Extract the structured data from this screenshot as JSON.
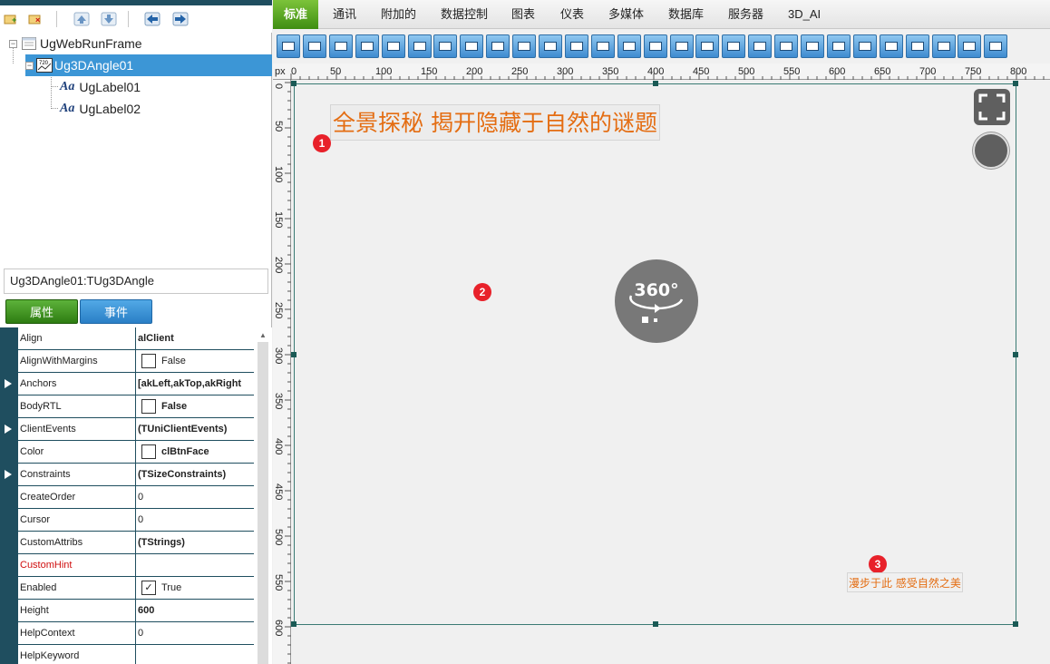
{
  "tree": {
    "root": "UgWebRunFrame",
    "selected": "Ug3DAngle01",
    "children": [
      "UgLabel01",
      "UgLabel02"
    ]
  },
  "component_name": "Ug3DAngle01:TUg3DAngle",
  "prop_tabs": {
    "properties": "属性",
    "events": "事件"
  },
  "properties": [
    {
      "name": "Align",
      "value": "alClient",
      "bold": true
    },
    {
      "name": "AlignWithMargins",
      "value": "False",
      "checkbox": "",
      "bold": false
    },
    {
      "name": "Anchors",
      "value": "[akLeft,akTop,akRight",
      "bold": true,
      "expandable": true
    },
    {
      "name": "BodyRTL",
      "value": "False",
      "checkbox": "",
      "bold": true
    },
    {
      "name": "ClientEvents",
      "value": "(TUniClientEvents)",
      "bold": true,
      "expandable": true
    },
    {
      "name": "Color",
      "value": "clBtnFace",
      "checkbox": "",
      "bold": true
    },
    {
      "name": "Constraints",
      "value": "(TSizeConstraints)",
      "bold": true,
      "expandable": true
    },
    {
      "name": "CreateOrder",
      "value": "0",
      "bold": false
    },
    {
      "name": "Cursor",
      "value": "0",
      "bold": false
    },
    {
      "name": "CustomAttribs",
      "value": "(TStrings)",
      "bold": true
    },
    {
      "name": "CustomHint",
      "value": "",
      "bold": false,
      "red": true
    },
    {
      "name": "Enabled",
      "value": "True",
      "checkbox": "✓",
      "bold": false
    },
    {
      "name": "Height",
      "value": "600",
      "bold": true
    },
    {
      "name": "HelpContext",
      "value": "0",
      "bold": false
    },
    {
      "name": "HelpKeyword",
      "value": "",
      "bold": false
    }
  ],
  "menu_tabs": [
    "标准",
    "通讯",
    "附加的",
    "数据控制",
    "图表",
    "仪表",
    "多媒体",
    "数据库",
    "服务器",
    "3D_AI"
  ],
  "active_tab": "标准",
  "ruler": {
    "unit": "px",
    "top_labels": [
      "0",
      "50",
      "100",
      "150",
      "200",
      "250",
      "300",
      "350",
      "400",
      "450",
      "500",
      "550",
      "600",
      "650",
      "700",
      "750",
      "800"
    ],
    "left_labels": [
      "0",
      "50",
      "100",
      "150",
      "200",
      "250",
      "300",
      "350",
      "400",
      "450",
      "500",
      "550",
      "600"
    ]
  },
  "canvas": {
    "title_text": "全景探秘 揭开隐藏于自然的谜题",
    "sub_text": "漫步于此 感受自然之美",
    "pano_text": "360°",
    "badges": [
      "1",
      "2",
      "3"
    ]
  },
  "colors": {
    "accent_green": "#3f8e12",
    "accent_blue": "#3c96d6",
    "label_orange": "#e46d12",
    "badge_red": "#e8212a",
    "frame_dark": "#1f4e5f"
  }
}
